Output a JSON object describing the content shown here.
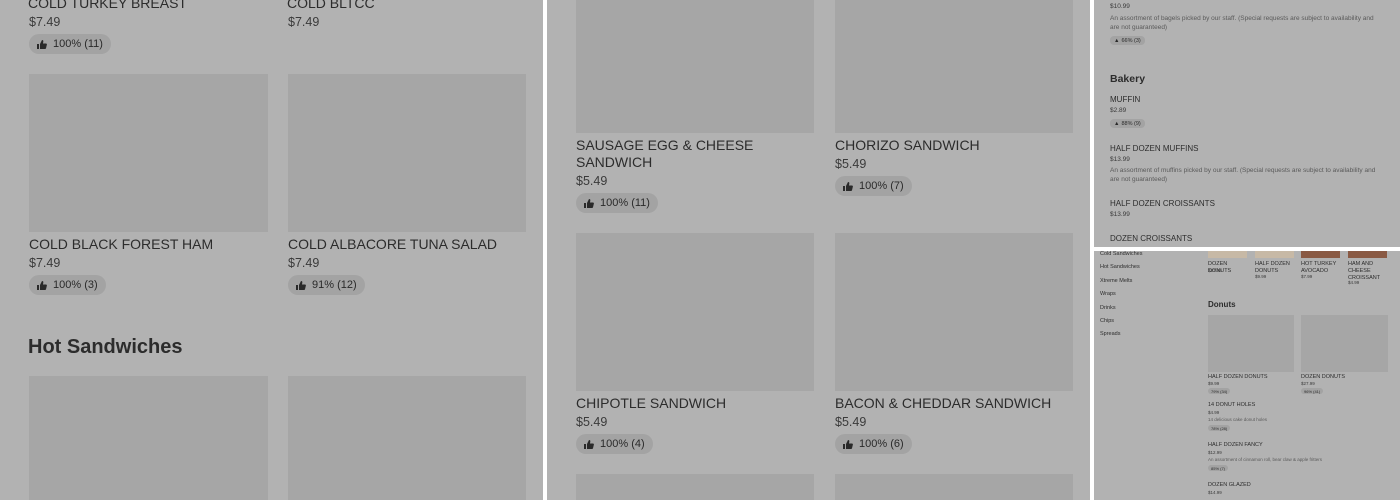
{
  "panel1": {
    "items": [
      {
        "title": "COLD TURKEY BREAST",
        "price": "$7.49",
        "rating": "100% (11)"
      },
      {
        "title": "COLD BLTCC",
        "price": "$7.49"
      },
      {
        "title": "COLD BLACK FOREST HAM",
        "price": "$7.49",
        "rating": "100% (3)"
      },
      {
        "title": "COLD ALBACORE TUNA SALAD",
        "price": "$7.49",
        "rating": "91% (12)"
      }
    ],
    "section_heading": "Hot Sandwiches"
  },
  "panel2": {
    "items": [
      {
        "title": "SAUSAGE EGG & CHEESE SANDWICH",
        "price": "$5.49",
        "rating": "100% (11)"
      },
      {
        "title": "CHORIZO SANDWICH",
        "price": "$5.49",
        "rating": "100% (7)"
      },
      {
        "title": "CHIPOTLE SANDWICH",
        "price": "$5.49",
        "rating": "100% (4)"
      },
      {
        "title": "BACON & CHEDDAR SANDWICH",
        "price": "$5.49",
        "rating": "100% (6)"
      }
    ]
  },
  "panel3": {
    "top_price": "$10.99",
    "top_desc": "An assortment of bagels picked by our staff. (Special requests are subject to availability and are not guaranteed)",
    "top_rating": "66% (3)",
    "section_heading": "Bakery",
    "items": [
      {
        "title": "MUFFIN",
        "price": "$2.89",
        "rating": "88% (9)"
      },
      {
        "title": "HALF DOZEN MUFFINS",
        "price": "$13.99",
        "desc": "An assortment of muffins picked by our staff. (Special requests are subject to availability and are not guaranteed)"
      },
      {
        "title": "HALF DOZEN CROISSANTS",
        "price": "$13.99"
      },
      {
        "title": "DOZEN CROISSANTS"
      }
    ]
  },
  "panel4": {
    "nav": [
      "Cold Sandwiches",
      "Hot Sandwiches",
      "Xtreme Melts",
      "Wraps",
      "Drinks",
      "Chips",
      "Spreads"
    ],
    "top_items": [
      {
        "title": "DOZEN DONUTS",
        "price": "$27.99"
      },
      {
        "title": "HALF DOZEN DONUTS",
        "price": "$9.99"
      },
      {
        "title": "HOT TURKEY AVOCADO",
        "price": "$7.99"
      },
      {
        "title": "HAM AND CHEESE CROISSANT",
        "price": "$4.99"
      }
    ],
    "section_heading": "Donuts",
    "grid_items": [
      {
        "title": "HALF DOZEN DONUTS",
        "price": "$9.99",
        "rating": "79% (34)"
      },
      {
        "title": "DOZEN DONUTS",
        "price": "$27.99",
        "rating": "96% (41)"
      }
    ],
    "list_items": [
      {
        "title": "14 DONUT HOLES",
        "price": "$4.99",
        "desc": "14 delicious cake donut holes",
        "rating": "78% (28)"
      },
      {
        "title": "HALF DOZEN FANCY",
        "price": "$12.99",
        "desc": "An assortment of cinnamon roll, bear claw & apple fritters",
        "rating": "85% (7)"
      },
      {
        "title": "DOZEN GLAZED",
        "price": "$14.99"
      }
    ]
  }
}
